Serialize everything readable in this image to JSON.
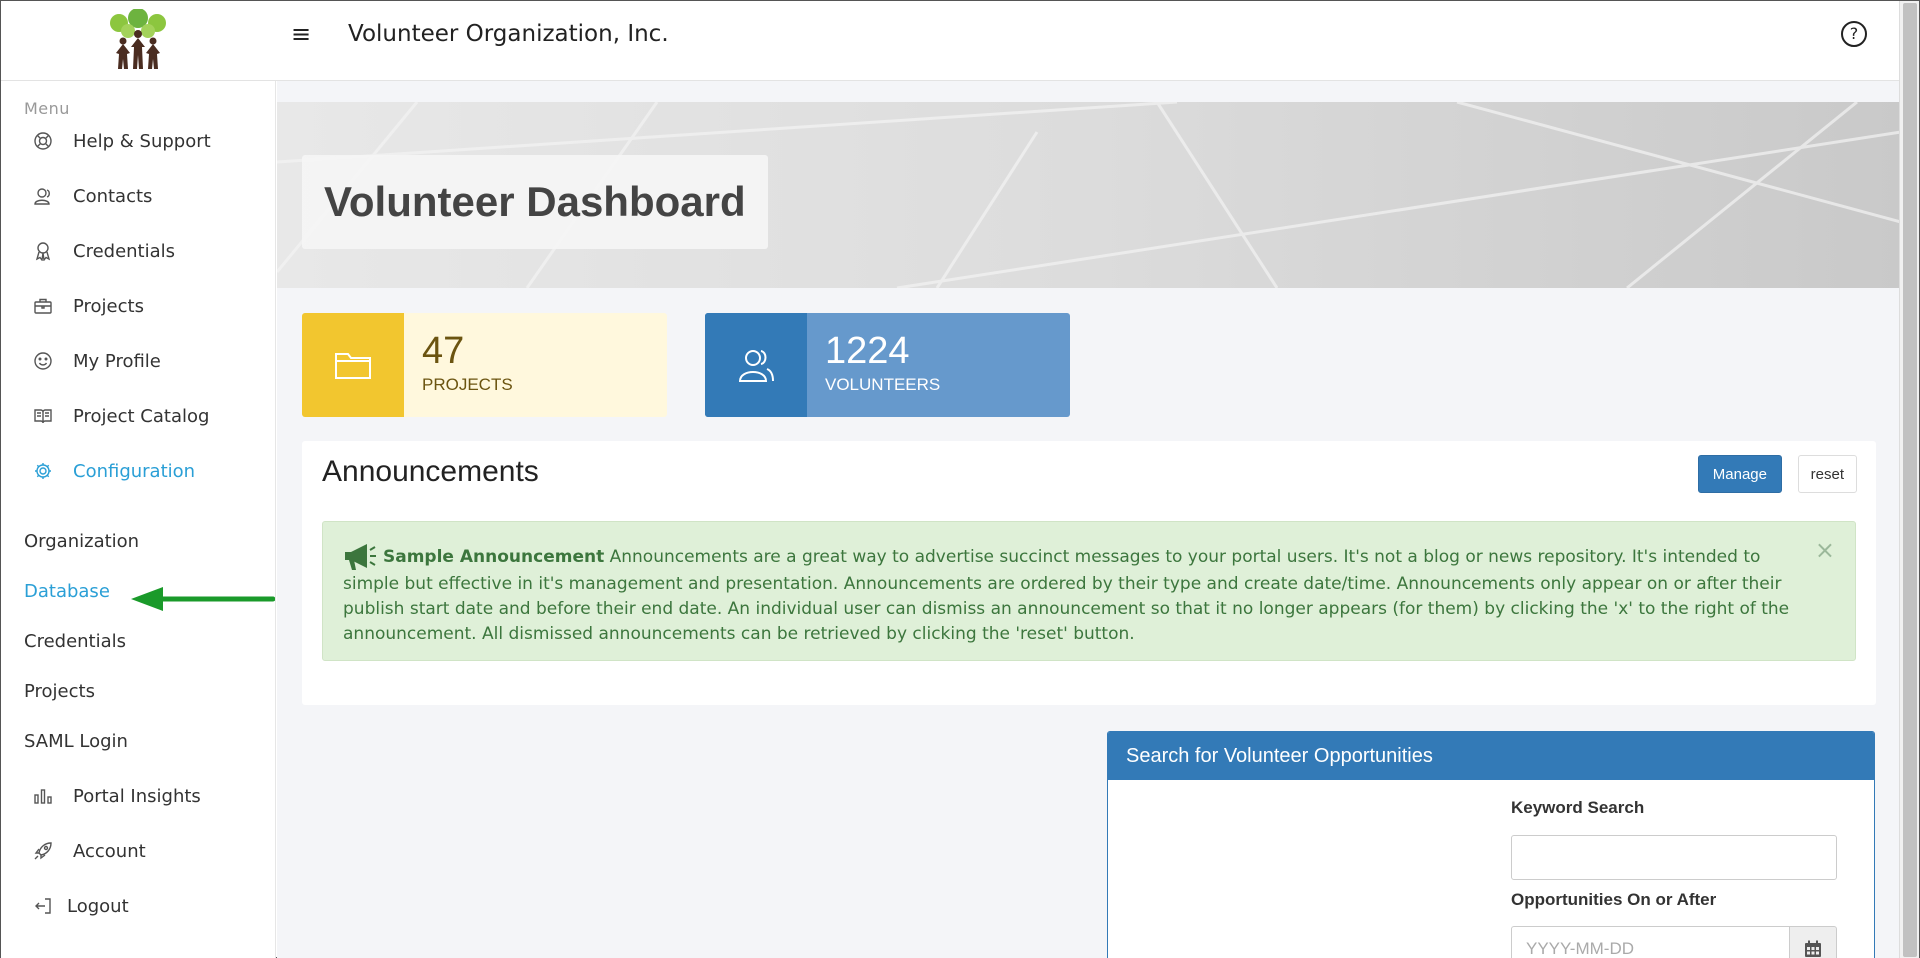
{
  "header": {
    "org_name": "Volunteer Organization, Inc.",
    "menu_icon": "hamburger-icon",
    "help_label": "?"
  },
  "sidebar": {
    "menu_label": "Menu",
    "items": [
      {
        "label": "Help & Support",
        "icon": "lifebuoy-icon"
      },
      {
        "label": "Contacts",
        "icon": "contacts-icon"
      },
      {
        "label": "Credentials",
        "icon": "award-icon"
      },
      {
        "label": "Projects",
        "icon": "briefcase-icon"
      },
      {
        "label": "My Profile",
        "icon": "smiley-icon"
      },
      {
        "label": "Project Catalog",
        "icon": "book-icon"
      },
      {
        "label": "Configuration",
        "icon": "gear-icon",
        "active": true
      }
    ],
    "sub_items": [
      {
        "label": "Organization"
      },
      {
        "label": "Database",
        "active": true
      },
      {
        "label": "Credentials"
      },
      {
        "label": "Projects"
      },
      {
        "label": "SAML Login"
      }
    ],
    "bottom_items": [
      {
        "label": "Portal Insights",
        "icon": "bar-chart-icon"
      },
      {
        "label": "Account",
        "icon": "rocket-icon"
      },
      {
        "label": "Logout",
        "icon": "logout-icon"
      }
    ]
  },
  "hero": {
    "title": "Volunteer Dashboard"
  },
  "stats": {
    "projects": {
      "value": "47",
      "label": "PROJECTS",
      "icon": "folder-icon"
    },
    "volunteers": {
      "value": "1224",
      "label": "VOLUNTEERS",
      "icon": "users-icon"
    }
  },
  "announcements": {
    "title": "Announcements",
    "manage_label": "Manage",
    "reset_label": "reset",
    "items": [
      {
        "title": "Sample Announcement",
        "body": "Announcements are a great way to advertise succinct messages to your portal users. It's not a blog or news repository. It's intended to simple but effective in it's management and presentation. Announcements are ordered by their type and create date/time. Announcements only appear on or after their publish start date and before their end date. An individual user can dismiss an announcement so that it no longer appears (for them) by clicking the 'x' to the right of the announcement. All dismissed announcements can be retrieved by clicking the 'reset' button.",
        "close_label": "×"
      }
    ]
  },
  "search": {
    "title": "Search for Volunteer Opportunities",
    "keyword_label": "Keyword Search",
    "keyword_value": "",
    "date_label": "Opportunities On or After",
    "date_placeholder": "YYYY-MM-DD"
  },
  "colors": {
    "accent": "#2a9fd6",
    "primary": "#337ab7",
    "projects_yellow": "#f2c62f",
    "success_bg": "#dff0d8",
    "arrow_green": "#1a9a2a"
  }
}
